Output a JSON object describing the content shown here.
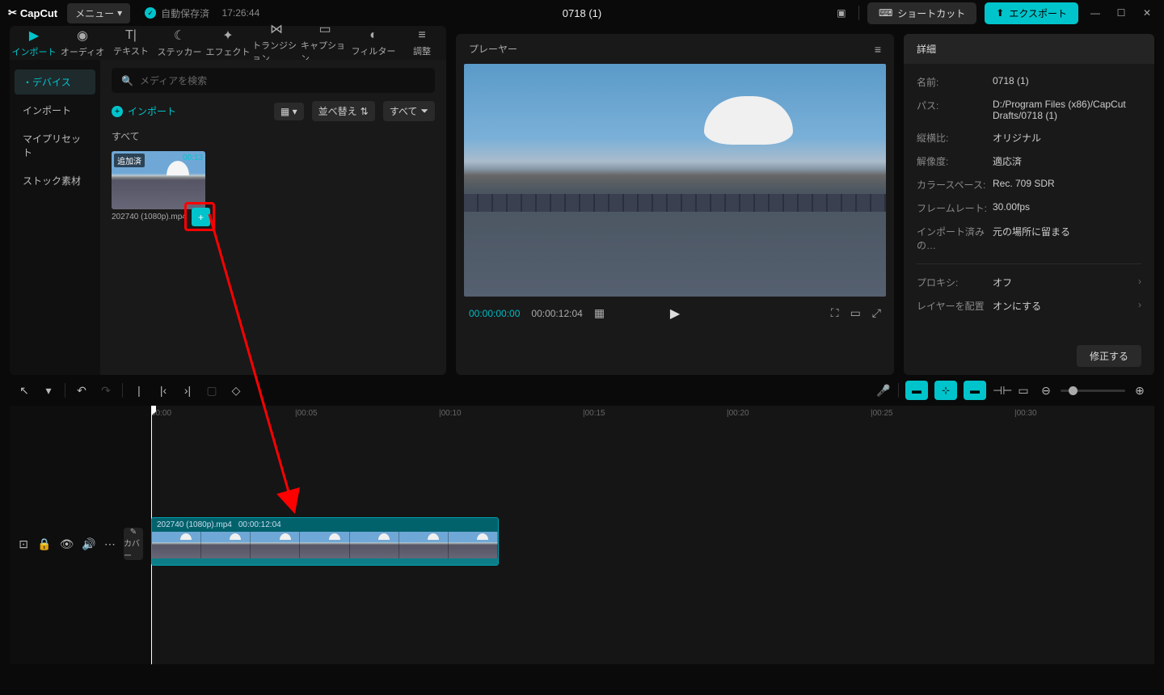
{
  "titlebar": {
    "logo": "CapCut",
    "menu": "メニュー",
    "autosave": "自動保存済",
    "autosave_time": "17:26:44",
    "project_title": "0718 (1)",
    "shortcut": "ショートカット",
    "export": "エクスポート"
  },
  "tabs": [
    {
      "label": "インポート",
      "icon": "▶"
    },
    {
      "label": "オーディオ",
      "icon": "◉"
    },
    {
      "label": "テキスト",
      "icon": "T|"
    },
    {
      "label": "ステッカー",
      "icon": "☾"
    },
    {
      "label": "エフェクト",
      "icon": "✦"
    },
    {
      "label": "トランジション",
      "icon": "⋈"
    },
    {
      "label": "キャプション",
      "icon": "▭"
    },
    {
      "label": "フィルター",
      "icon": "◐"
    },
    {
      "label": "調整",
      "icon": "≡"
    }
  ],
  "side_items": [
    "・デバイス",
    "インポート",
    "マイプリセット",
    "ストック素材"
  ],
  "media": {
    "search_placeholder": "メディアを検索",
    "import_label": "インポート",
    "sort_label": "並べ替え",
    "all_label": "すべて",
    "filter_label": "すべて",
    "thumb_badge": "追加済",
    "thumb_time": "00:13",
    "thumb_name": "202740 (1080p).mp4"
  },
  "player": {
    "title": "プレーヤー",
    "tc_current": "00:00:00:00",
    "tc_total": "00:00:12:04"
  },
  "detail": {
    "title": "詳細",
    "rows": [
      {
        "k": "名前:",
        "v": "0718 (1)"
      },
      {
        "k": "パス:",
        "v": "D:/Program Files (x86)/CapCut Drafts/0718 (1)"
      },
      {
        "k": "縦横比:",
        "v": "オリジナル"
      },
      {
        "k": "解像度:",
        "v": "適応済"
      },
      {
        "k": "カラースペース:",
        "v": "Rec. 709 SDR"
      },
      {
        "k": "フレームレート:",
        "v": "30.00fps"
      },
      {
        "k": "インポート済みの…",
        "v": "元の場所に留まる"
      }
    ],
    "proxy_k": "プロキシ:",
    "proxy_v": "オフ",
    "layer_k": "レイヤーを配置",
    "layer_v": "オンにする",
    "fix": "修正する"
  },
  "timeline": {
    "ruler": [
      "00:00",
      "|00:05",
      "|00:10",
      "|00:15",
      "|00:20",
      "|00:25",
      "|00:30"
    ],
    "cover": "カバー",
    "clip_name": "202740 (1080p).mp4",
    "clip_duration": "00:00:12:04"
  }
}
